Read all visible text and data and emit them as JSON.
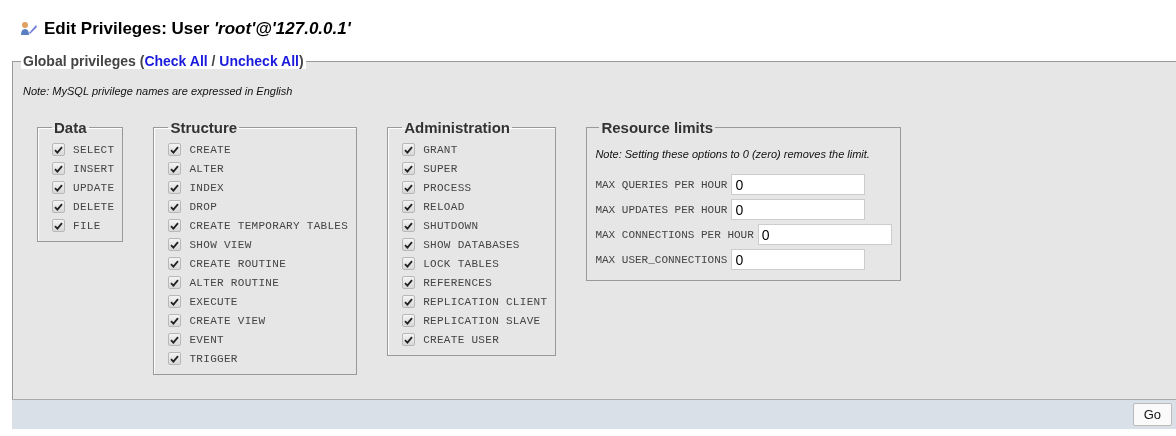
{
  "title": "Edit Privileges: User *'root'@'127.0.0.1'*",
  "legend": {
    "text_before": "Global privileges (",
    "check_all": "Check All",
    "separator": " / ",
    "uncheck_all": "Uncheck All",
    "text_after": ")"
  },
  "note": "Note: MySQL privilege names are expressed in English",
  "groups": [
    {
      "title": "Data",
      "privileges": [
        {
          "label": "SELECT",
          "checked": true
        },
        {
          "label": "INSERT",
          "checked": true
        },
        {
          "label": "UPDATE",
          "checked": true
        },
        {
          "label": "DELETE",
          "checked": true
        },
        {
          "label": "FILE",
          "checked": true
        }
      ]
    },
    {
      "title": "Structure",
      "privileges": [
        {
          "label": "CREATE",
          "checked": true
        },
        {
          "label": "ALTER",
          "checked": true
        },
        {
          "label": "INDEX",
          "checked": true
        },
        {
          "label": "DROP",
          "checked": true
        },
        {
          "label": "CREATE TEMPORARY TABLES",
          "checked": true
        },
        {
          "label": "SHOW VIEW",
          "checked": true
        },
        {
          "label": "CREATE ROUTINE",
          "checked": true
        },
        {
          "label": "ALTER ROUTINE",
          "checked": true
        },
        {
          "label": "EXECUTE",
          "checked": true
        },
        {
          "label": "CREATE VIEW",
          "checked": true
        },
        {
          "label": "EVENT",
          "checked": true
        },
        {
          "label": "TRIGGER",
          "checked": true
        }
      ]
    },
    {
      "title": "Administration",
      "privileges": [
        {
          "label": "GRANT",
          "checked": true
        },
        {
          "label": "SUPER",
          "checked": true
        },
        {
          "label": "PROCESS",
          "checked": true
        },
        {
          "label": "RELOAD",
          "checked": true
        },
        {
          "label": "SHUTDOWN",
          "checked": true
        },
        {
          "label": "SHOW DATABASES",
          "checked": true
        },
        {
          "label": "LOCK TABLES",
          "checked": true
        },
        {
          "label": "REFERENCES",
          "checked": true
        },
        {
          "label": "REPLICATION CLIENT",
          "checked": true
        },
        {
          "label": "REPLICATION SLAVE",
          "checked": true
        },
        {
          "label": "CREATE USER",
          "checked": true
        }
      ]
    }
  ],
  "resource_limits": {
    "title": "Resource limits",
    "note": "Note: Setting these options to 0 (zero) removes the limit.",
    "limits": [
      {
        "label": "MAX QUERIES PER HOUR",
        "value": "0"
      },
      {
        "label": "MAX UPDATES PER HOUR",
        "value": "0"
      },
      {
        "label": "MAX CONNECTIONS PER HOUR",
        "value": "0"
      },
      {
        "label": "MAX USER_CONNECTIONS",
        "value": "0"
      }
    ]
  },
  "buttons": [
    "Go"
  ]
}
